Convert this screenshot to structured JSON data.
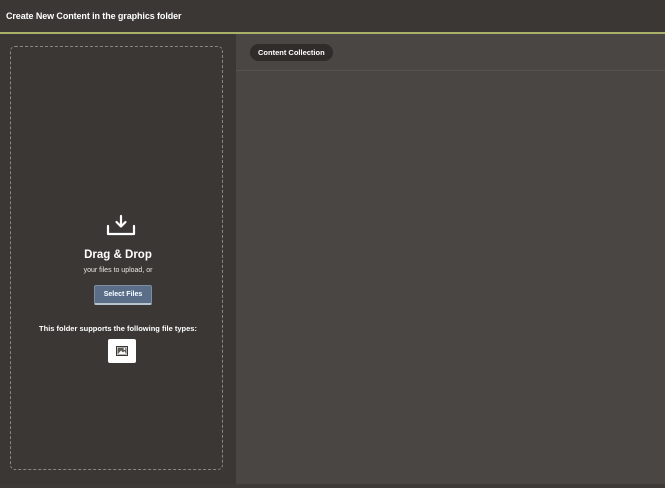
{
  "header": {
    "title": "Create New Content in the graphics folder"
  },
  "upload": {
    "icon": "upload-icon",
    "title": "Drag & Drop",
    "subtitle": "your files to upload, or",
    "select_button_label": "Select Files",
    "supports_text": "This folder supports the following file types:",
    "file_types": [
      {
        "icon": "image-icon"
      }
    ]
  },
  "content": {
    "collection_label": "Content Collection"
  },
  "colors": {
    "accent": "#a8b06a",
    "button": "#5b6e87",
    "panel_dark": "#3a3734",
    "panel": "#4a4643"
  }
}
